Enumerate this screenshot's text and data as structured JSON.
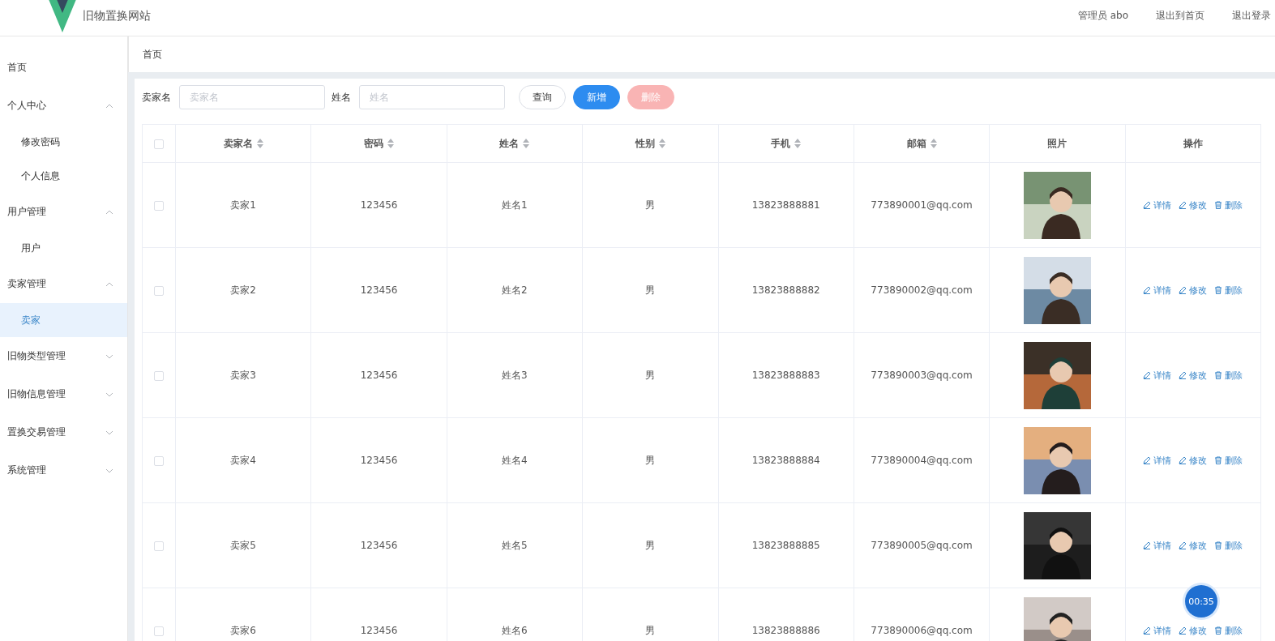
{
  "header": {
    "title": "旧物置换网站",
    "links": [
      "管理员 abo",
      "退出到首页",
      "退出登录"
    ]
  },
  "sidebar": {
    "items": [
      {
        "label": "首页",
        "selected": false
      },
      {
        "label": "个人中心",
        "expanded": true,
        "selected": false,
        "children": [
          {
            "label": "修改密码",
            "selected": false
          },
          {
            "label": "个人信息",
            "selected": false
          }
        ]
      },
      {
        "label": "用户管理",
        "expanded": true,
        "selected": false,
        "children": [
          {
            "label": "用户",
            "selected": false
          }
        ]
      },
      {
        "label": "卖家管理",
        "expanded": true,
        "selected": false,
        "children": [
          {
            "label": "卖家",
            "selected": true
          }
        ]
      },
      {
        "label": "旧物类型管理",
        "expanded": false,
        "selected": false
      },
      {
        "label": "旧物信息管理",
        "expanded": false,
        "selected": false
      },
      {
        "label": "置换交易管理",
        "expanded": false,
        "selected": false
      },
      {
        "label": "系统管理",
        "expanded": false,
        "selected": false
      }
    ]
  },
  "breadcrumb": "首页",
  "search": {
    "fields": [
      {
        "label": "卖家名",
        "placeholder": "卖家名"
      },
      {
        "label": "姓名",
        "placeholder": "姓名"
      }
    ],
    "buttons": [
      {
        "label": "查询",
        "kind": "plain",
        "disabled": false
      },
      {
        "label": "新增",
        "kind": "primary",
        "disabled": false
      },
      {
        "label": "删除",
        "kind": "danger",
        "disabled": true
      }
    ]
  },
  "table": {
    "select_all_checked": false,
    "columns": [
      {
        "label": "卖家名",
        "sortable": true
      },
      {
        "label": "密码",
        "sortable": true
      },
      {
        "label": "姓名",
        "sortable": true
      },
      {
        "label": "性别",
        "sortable": true
      },
      {
        "label": "手机",
        "sortable": true
      },
      {
        "label": "邮箱",
        "sortable": true
      },
      {
        "label": "照片",
        "sortable": false
      },
      {
        "label": "操作",
        "sortable": false
      }
    ],
    "rows": [
      {
        "checked": false,
        "cells": [
          "卖家1",
          "123456",
          "姓名1",
          "男",
          "13823888881",
          "773890001@qq.com"
        ],
        "actions": [
          "详情",
          "修改",
          "删除"
        ]
      },
      {
        "checked": false,
        "cells": [
          "卖家2",
          "123456",
          "姓名2",
          "男",
          "13823888882",
          "773890002@qq.com"
        ],
        "actions": [
          "详情",
          "修改",
          "删除"
        ]
      },
      {
        "checked": false,
        "cells": [
          "卖家3",
          "123456",
          "姓名3",
          "男",
          "13823888883",
          "773890003@qq.com"
        ],
        "actions": [
          "详情",
          "修改",
          "删除"
        ]
      },
      {
        "checked": false,
        "cells": [
          "卖家4",
          "123456",
          "姓名4",
          "男",
          "13823888884",
          "773890004@qq.com"
        ],
        "actions": [
          "详情",
          "修改",
          "删除"
        ]
      },
      {
        "checked": false,
        "cells": [
          "卖家5",
          "123456",
          "姓名5",
          "男",
          "13823888885",
          "773890005@qq.com"
        ],
        "actions": [
          "详情",
          "修改",
          "删除"
        ]
      },
      {
        "checked": false,
        "cells": [
          "卖家6",
          "123456",
          "姓名6",
          "男",
          "13823888886",
          "773890006@qq.com"
        ],
        "actions": [
          "详情",
          "修改",
          "删除"
        ]
      }
    ]
  },
  "recorder_timer": "00:35"
}
